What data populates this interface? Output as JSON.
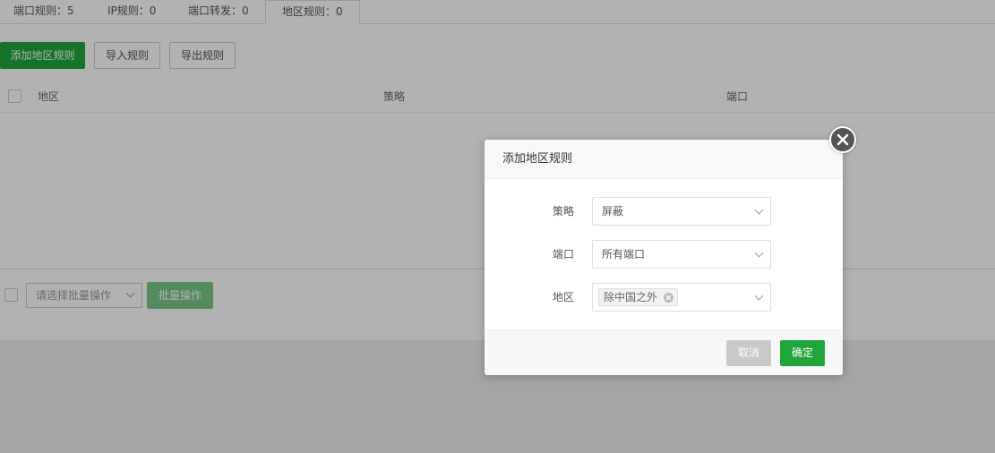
{
  "tabs": [
    {
      "label": "端口规则：5"
    },
    {
      "label": "IP规则：0"
    },
    {
      "label": "端口转发：0"
    },
    {
      "label": "地区规则：0"
    }
  ],
  "toolbar": {
    "add_label": "添加地区规则",
    "import_label": "导入规则",
    "export_label": "导出规则"
  },
  "table": {
    "columns": [
      "地区",
      "策略",
      "端口"
    ]
  },
  "bulk": {
    "select_placeholder": "请选择批量操作",
    "apply_label": "批量操作"
  },
  "modal": {
    "title": "添加地区规则",
    "fields": {
      "policy": {
        "label": "策略",
        "value": "屏蔽"
      },
      "port": {
        "label": "端口",
        "value": "所有端口"
      },
      "region": {
        "label": "地区",
        "tag": "除中国之外"
      }
    },
    "cancel_label": "取消",
    "confirm_label": "确定"
  },
  "colors": {
    "accent": "#20a53a",
    "overlay": "rgba(0,0,0,0.3)"
  }
}
